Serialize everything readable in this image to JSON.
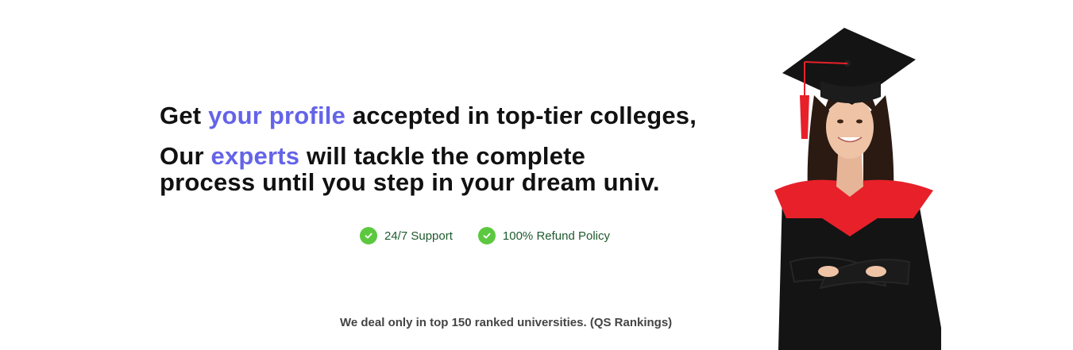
{
  "hero": {
    "headline": {
      "part1": "Get ",
      "highlight": "your profile",
      "part2": " accepted in top-tier colleges,"
    },
    "subheadline": {
      "part1": "Our ",
      "highlight": "experts",
      "part2": " will tackle the complete",
      "line2": "process until you step in your dream univ."
    },
    "features": [
      {
        "label": "24/7 Support",
        "icon": "check-circle-icon"
      },
      {
        "label": "100% Refund Policy",
        "icon": "check-circle-icon"
      }
    ],
    "footnote": "We deal only in top 150 ranked universities. (QS Rankings)"
  },
  "colors": {
    "accent": "#6464e8",
    "text": "#111111",
    "check": "#5cc840",
    "feature_text": "#1f5a2e",
    "gown_accent": "#e8202a"
  }
}
